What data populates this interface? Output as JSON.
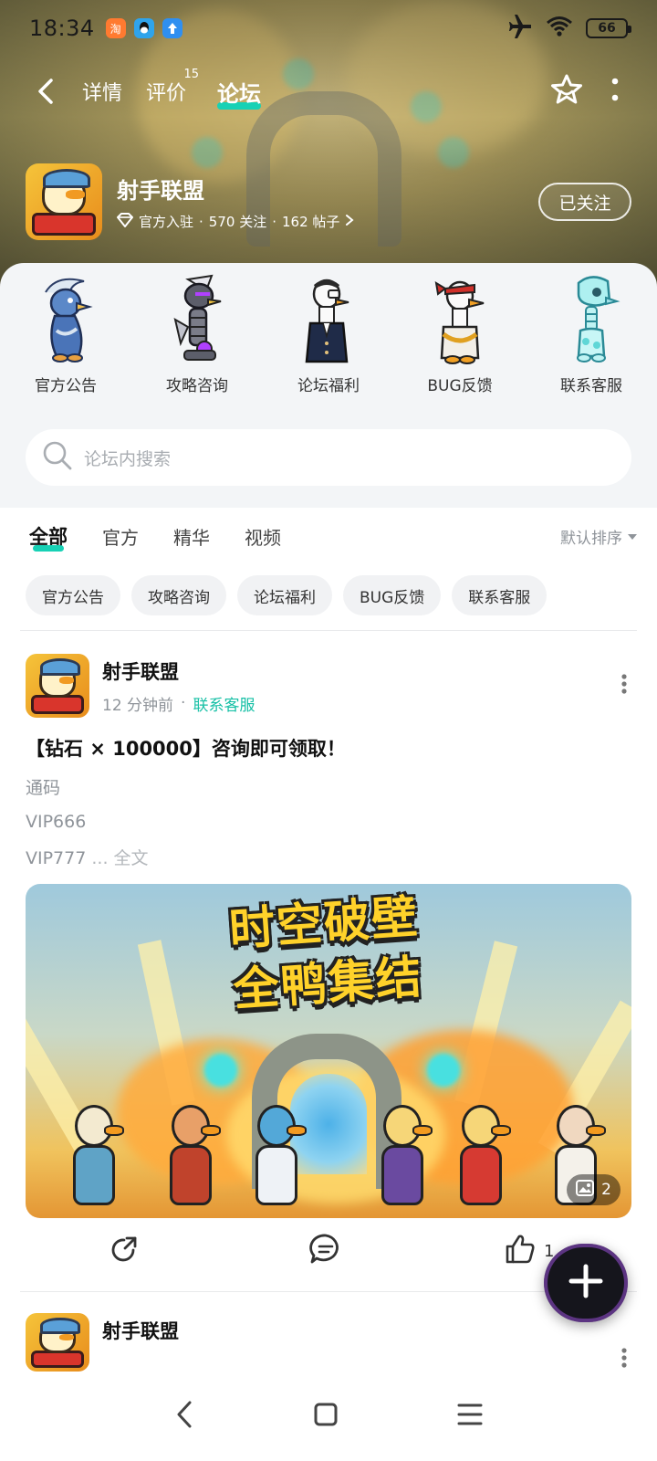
{
  "status_bar": {
    "time": "18:34",
    "battery": "66",
    "notification_icons": [
      "taobao-app-icon",
      "qq-app-icon",
      "upload-arrow-icon"
    ],
    "system_icons": [
      "airplane-mode-icon",
      "wifi-icon",
      "battery-icon"
    ]
  },
  "nav": {
    "tabs": [
      {
        "label": "详情",
        "badge": ""
      },
      {
        "label": "评价",
        "badge": "15"
      },
      {
        "label": "论坛",
        "badge": ""
      }
    ],
    "active_tab": "论坛"
  },
  "game": {
    "name": "射手联盟",
    "verified_label": "官方入驻",
    "follow_count": "570 关注",
    "post_count": "162 帖子",
    "follow_button": "已关注"
  },
  "forum": {
    "categories": [
      {
        "label": "官方公告",
        "icon": "pigeon-character"
      },
      {
        "label": "攻略咨询",
        "icon": "robot-duck-character"
      },
      {
        "label": "论坛福利",
        "icon": "goose-glasses-character"
      },
      {
        "label": "BUG反馈",
        "icon": "duck-ninja-character"
      },
      {
        "label": "联系客服",
        "icon": "ghost-skeleton-character"
      }
    ],
    "search_placeholder": "论坛内搜索"
  },
  "feed": {
    "tabs": [
      "全部",
      "官方",
      "精华",
      "视频"
    ],
    "active_tab": "全部",
    "sort_label": "默认排序",
    "chips": [
      "官方公告",
      "攻略咨询",
      "论坛福利",
      "BUG反馈",
      "联系客服"
    ]
  },
  "posts": [
    {
      "author": "射手联盟",
      "time": "12 分钟前",
      "separator": "·",
      "tag": "联系客服",
      "title": "【钻石 × 100000】咨询即可领取！",
      "lines": [
        "通码",
        "VIP666",
        "VIP777"
      ],
      "ellipsis": " ... ",
      "full_text_label": "全文",
      "banner_text_line1": "时空破壁",
      "banner_text_line2": "全鸭集结",
      "image_count": "2",
      "like_count": "1"
    },
    {
      "author": "射手联盟"
    }
  ],
  "colors": {
    "accent": "#17d1b5",
    "tag_text": "#17c0a6",
    "muted": "#8f949a"
  }
}
